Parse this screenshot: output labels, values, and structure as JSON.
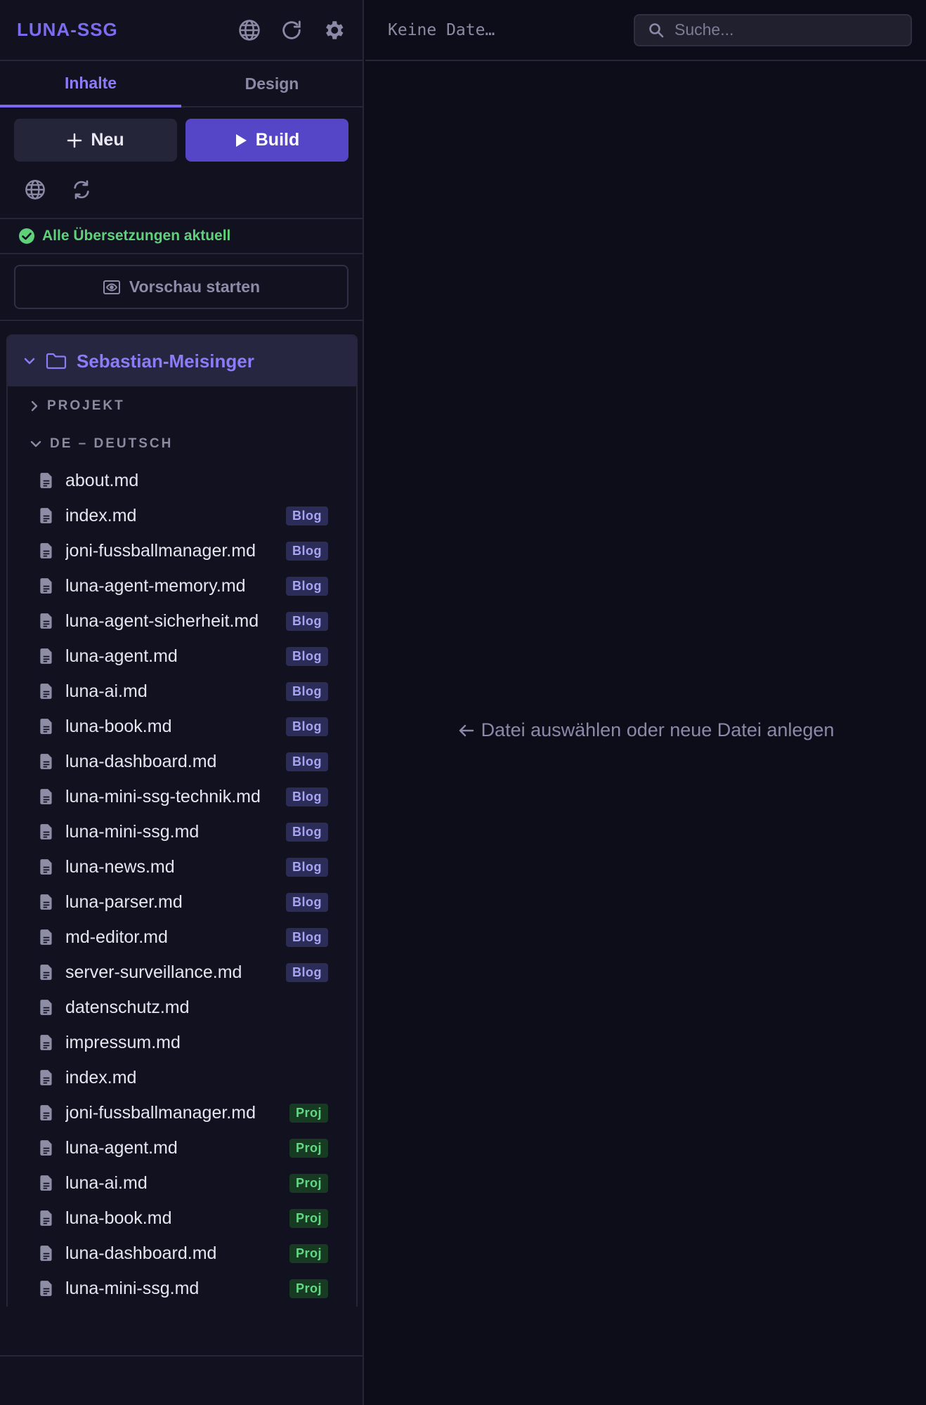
{
  "app": {
    "title": "LUNA-SSG"
  },
  "header_icons": [
    "globe-icon",
    "refresh-icon",
    "gear-icon"
  ],
  "tabs": [
    {
      "label": "Inhalte",
      "active": true
    },
    {
      "label": "Design",
      "active": false
    }
  ],
  "actions": {
    "new_label": "Neu",
    "build_label": "Build"
  },
  "tool_icons": [
    "globe-icon",
    "sync-icon"
  ],
  "status": {
    "text": "Alle Übersetzungen aktuell",
    "color": "#5fd17b"
  },
  "preview": {
    "label": "Vorschau starten"
  },
  "tree": {
    "root": "Sebastian-Meisinger",
    "groups": [
      {
        "label": "PROJEKT",
        "expanded": false
      },
      {
        "label": "DE – DEUTSCH",
        "expanded": true
      }
    ],
    "files": [
      {
        "name": "about.md",
        "badge": ""
      },
      {
        "name": "index.md",
        "badge": "Blog"
      },
      {
        "name": "joni-fussballmanager.md",
        "badge": "Blog"
      },
      {
        "name": "luna-agent-memory.md",
        "badge": "Blog"
      },
      {
        "name": "luna-agent-sicherheit.md",
        "badge": "Blog"
      },
      {
        "name": "luna-agent.md",
        "badge": "Blog"
      },
      {
        "name": "luna-ai.md",
        "badge": "Blog"
      },
      {
        "name": "luna-book.md",
        "badge": "Blog"
      },
      {
        "name": "luna-dashboard.md",
        "badge": "Blog"
      },
      {
        "name": "luna-mini-ssg-technik.md",
        "badge": "Blog"
      },
      {
        "name": "luna-mini-ssg.md",
        "badge": "Blog"
      },
      {
        "name": "luna-news.md",
        "badge": "Blog"
      },
      {
        "name": "luna-parser.md",
        "badge": "Blog"
      },
      {
        "name": "md-editor.md",
        "badge": "Blog"
      },
      {
        "name": "server-surveillance.md",
        "badge": "Blog"
      },
      {
        "name": "datenschutz.md",
        "badge": ""
      },
      {
        "name": "impressum.md",
        "badge": ""
      },
      {
        "name": "index.md",
        "badge": ""
      },
      {
        "name": "joni-fussballmanager.md",
        "badge": "Proj"
      },
      {
        "name": "luna-agent.md",
        "badge": "Proj"
      },
      {
        "name": "luna-ai.md",
        "badge": "Proj"
      },
      {
        "name": "luna-book.md",
        "badge": "Proj"
      },
      {
        "name": "luna-dashboard.md",
        "badge": "Proj"
      },
      {
        "name": "luna-mini-ssg.md",
        "badge": "Proj"
      }
    ]
  },
  "main": {
    "current_file": "Keine Date…",
    "search_placeholder": "Suche...",
    "empty_message": "Datei auswählen oder neue Datei anlegen"
  },
  "colors": {
    "accent": "#7c6cf0",
    "build_button": "#5446c7",
    "background": "#0d0d1a",
    "sidebar": "#11111f",
    "blog_badge": "#2c2c58",
    "proj_badge": "#173a22"
  }
}
